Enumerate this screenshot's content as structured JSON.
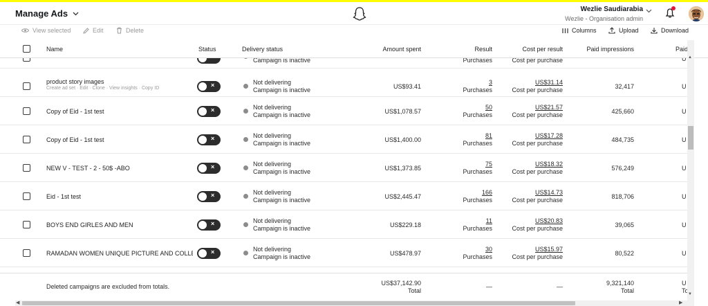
{
  "header": {
    "app_title": "Manage Ads",
    "user_name": "Wezlie Saudiarabia",
    "user_role": "Wezlie - Organisation admin"
  },
  "toolbar": {
    "view_selected": "View selected",
    "edit": "Edit",
    "delete": "Delete",
    "columns": "Columns",
    "upload": "Upload",
    "download": "Download"
  },
  "columns": {
    "name": "Name",
    "status": "Status",
    "delivery_status": "Delivery status",
    "amount_spent": "Amount spent",
    "result": "Result",
    "cost_per_result": "Cost per result",
    "paid_impressions": "Paid impressions",
    "paid_cut": "Paid"
  },
  "partial_row": {
    "delivery_line2": "Campaign is inactive",
    "result_unit": "Purchases",
    "cost_unit": "Cost per purchase",
    "right_cut": "U"
  },
  "rows": [
    {
      "name": "product story images",
      "actions": "Create ad set · Edit · Clone · View insights · Copy ID",
      "delivery": "Not delivering",
      "delivery_sub": "Campaign is inactive",
      "amount": "US$93.41",
      "result": "3",
      "result_unit": "Purchases",
      "cost": "US$31.14",
      "cost_unit": "Cost per purchase",
      "impressions": "32,417",
      "cut": "U"
    },
    {
      "name": "Copy of Eid - 1st test",
      "delivery": "Not delivering",
      "delivery_sub": "Campaign is inactive",
      "amount": "US$1,078.57",
      "result": "50",
      "result_unit": "Purchases",
      "cost": "US$21.57",
      "cost_unit": "Cost per purchase",
      "impressions": "425,660",
      "cut": "U"
    },
    {
      "name": "Copy of Eid - 1st test",
      "delivery": "Not delivering",
      "delivery_sub": "Campaign is inactive",
      "amount": "US$1,400.00",
      "result": "81",
      "result_unit": "Purchases",
      "cost": "US$17.28",
      "cost_unit": "Cost per purchase",
      "impressions": "484,735",
      "cut": "U"
    },
    {
      "name": "NEW V - TEST - 2 - 50$ -ABO",
      "delivery": "Not delivering",
      "delivery_sub": "Campaign is inactive",
      "amount": "US$1,373.85",
      "result": "75",
      "result_unit": "Purchases",
      "cost": "US$18.32",
      "cost_unit": "Cost per purchase",
      "impressions": "576,249",
      "cut": "U"
    },
    {
      "name": "Eid - 1st test",
      "delivery": "Not delivering",
      "delivery_sub": "Campaign is inactive",
      "amount": "US$2,445.47",
      "result": "166",
      "result_unit": "Purchases",
      "cost": "US$14.73",
      "cost_unit": "Cost per purchase",
      "impressions": "818,706",
      "cut": "U"
    },
    {
      "name": "BOYS END GIRLES AND MEN",
      "delivery": "Not delivering",
      "delivery_sub": "Campaign is inactive",
      "amount": "US$229.18",
      "result": "11",
      "result_unit": "Purchases",
      "cost": "US$20.83",
      "cost_unit": "Cost per purchase",
      "impressions": "39,065",
      "cut": "U"
    },
    {
      "name": "RAMADAN WOMEN UNIQUE PICTURE AND COLLECTIC",
      "delivery": "Not delivering",
      "delivery_sub": "Campaign is inactive",
      "amount": "US$478.97",
      "result": "30",
      "result_unit": "Purchases",
      "cost": "US$15.97",
      "cost_unit": "Cost per purchase",
      "impressions": "80,522",
      "cut": "U"
    }
  ],
  "footer": {
    "note": "Deleted campaigns are excluded from totals.",
    "amount_total": "US$37,142.90",
    "amount_label": "Total",
    "result_total": "—",
    "cost_total": "—",
    "impressions_total": "9,321,140",
    "impressions_label": "Total",
    "cut_top": "U",
    "cut_bottom": "Tot"
  }
}
